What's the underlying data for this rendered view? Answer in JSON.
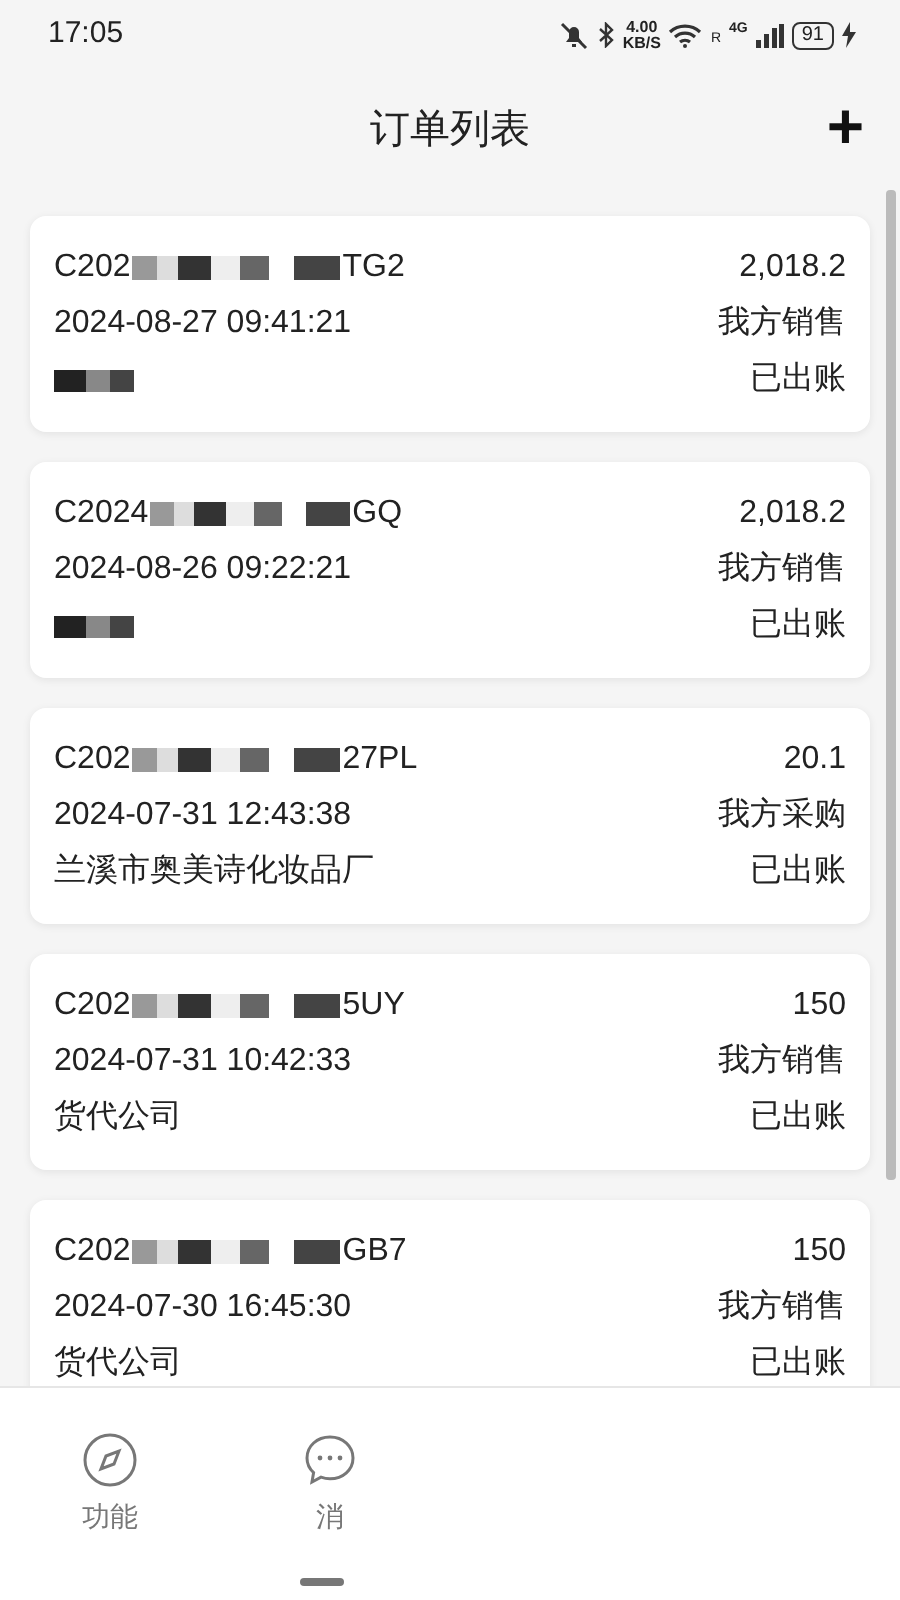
{
  "status_bar": {
    "time": "17:05",
    "speed_value": "4.00",
    "speed_unit": "KB/S",
    "roaming": "R",
    "network": "4G",
    "battery": "91",
    "charging": true
  },
  "header": {
    "title": "订单列表",
    "add_button": "+"
  },
  "orders": [
    {
      "id_start": "C202",
      "id_end": "TG2",
      "amount": "2,018.2",
      "date": "2024-08-27 09:41:21",
      "type": "我方销售",
      "party_redacted": true,
      "status": "已出账"
    },
    {
      "id_start": "C2024",
      "id_end": "GQ",
      "amount": "2,018.2",
      "date": "2024-08-26 09:22:21",
      "type": "我方销售",
      "party_redacted": true,
      "status": "已出账"
    },
    {
      "id_start": "C202",
      "id_end": "27PL",
      "amount": "20.1",
      "date": "2024-07-31 12:43:38",
      "type": "我方采购",
      "party": "兰溪市奥美诗化妆品厂",
      "status": "已出账"
    },
    {
      "id_start": "C202",
      "id_end": "5UY",
      "amount": "150",
      "date": "2024-07-31 10:42:33",
      "type": "我方销售",
      "party": "货代公司",
      "status": "已出账"
    },
    {
      "id_start": "C202",
      "id_end": "GB7",
      "amount": "150",
      "date": "2024-07-30 16:45:30",
      "type": "我方销售",
      "party": "货代公司",
      "status": "已出账"
    }
  ],
  "bottom_nav": [
    {
      "label": "功能",
      "kind": "compass",
      "selected": false
    },
    {
      "label": "消",
      "kind": "chat",
      "selected": false
    }
  ]
}
